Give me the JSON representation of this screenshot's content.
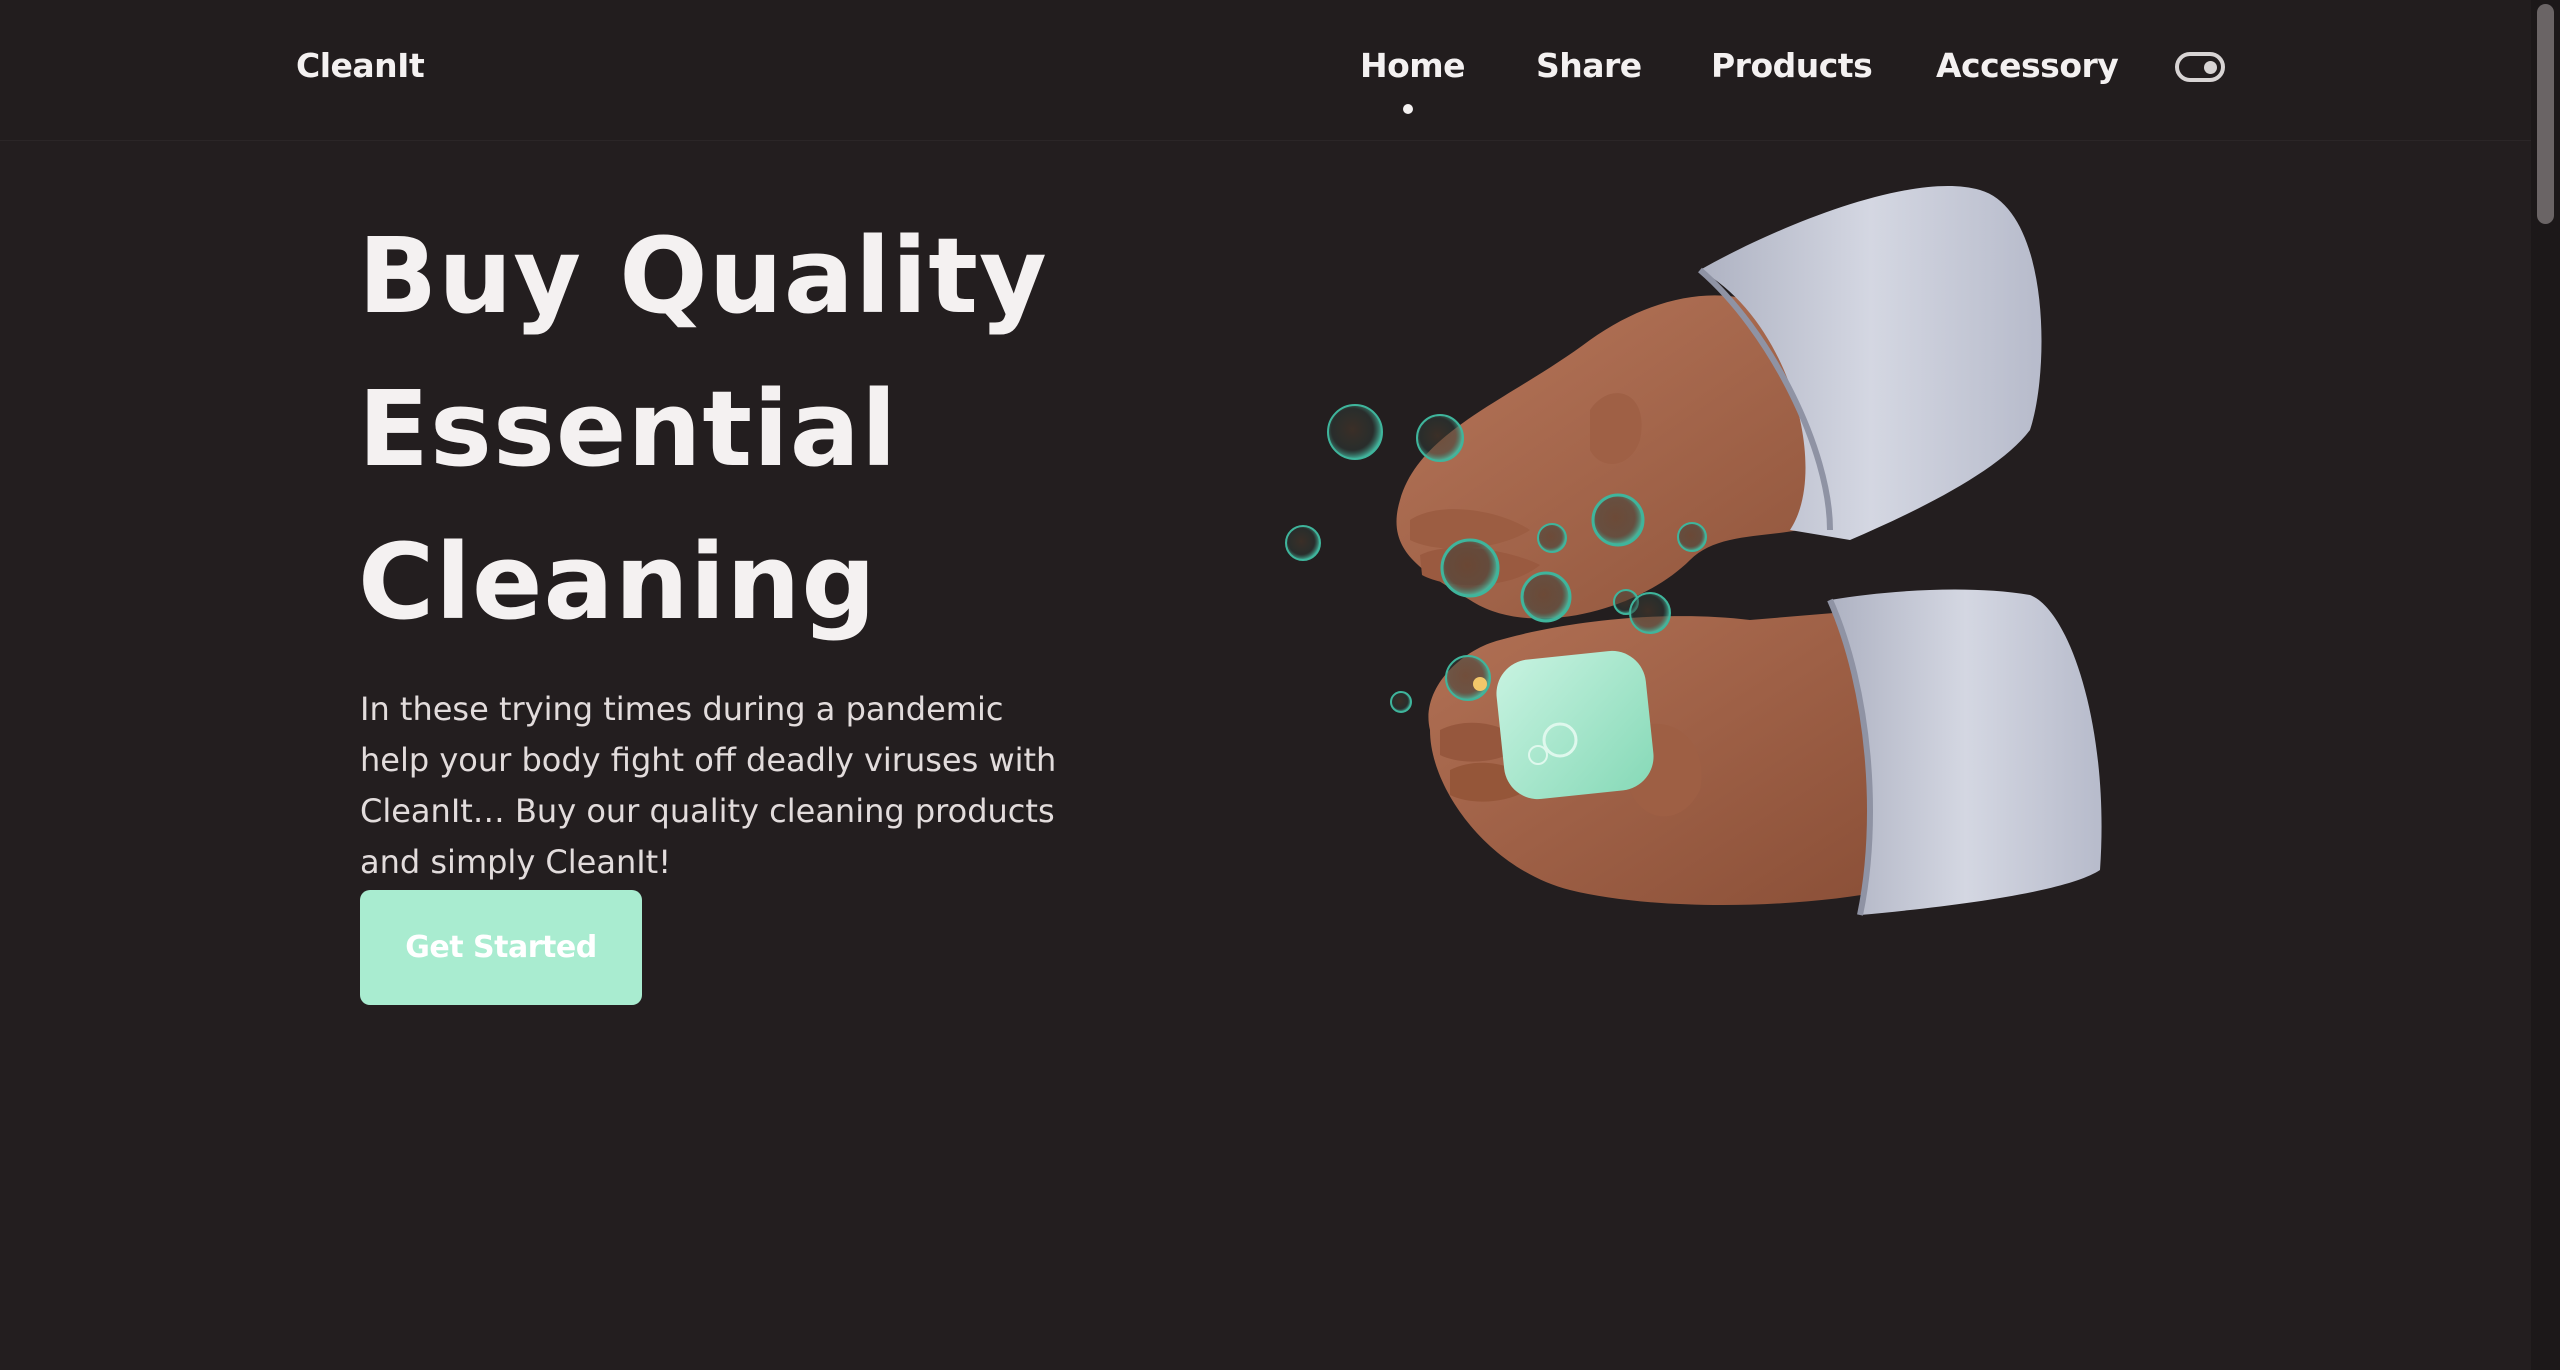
{
  "header": {
    "logo": "CleanIt",
    "nav": [
      {
        "label": "Home",
        "active": true
      },
      {
        "label": "Share",
        "active": false
      },
      {
        "label": "Products",
        "active": false
      },
      {
        "label": "Accessory",
        "active": false
      }
    ],
    "theme_toggle_icon": "toggle-switch-icon"
  },
  "hero": {
    "title_lines": [
      "Buy Quality",
      "Essential",
      "Cleaning"
    ],
    "description": "In these trying times during a pandemic help your body fight off deadly viruses with CleanIt… Buy our quality cleaning products and simply CleanIt!",
    "cta_label": "Get Started",
    "illustration_icon": "hands-washing-soap-icon"
  },
  "colors": {
    "background": "#231e1f",
    "text": "#f4f1f1",
    "accent": "#a9ecd0",
    "skin": "#a8674a",
    "cuff": "#c7cad6"
  }
}
